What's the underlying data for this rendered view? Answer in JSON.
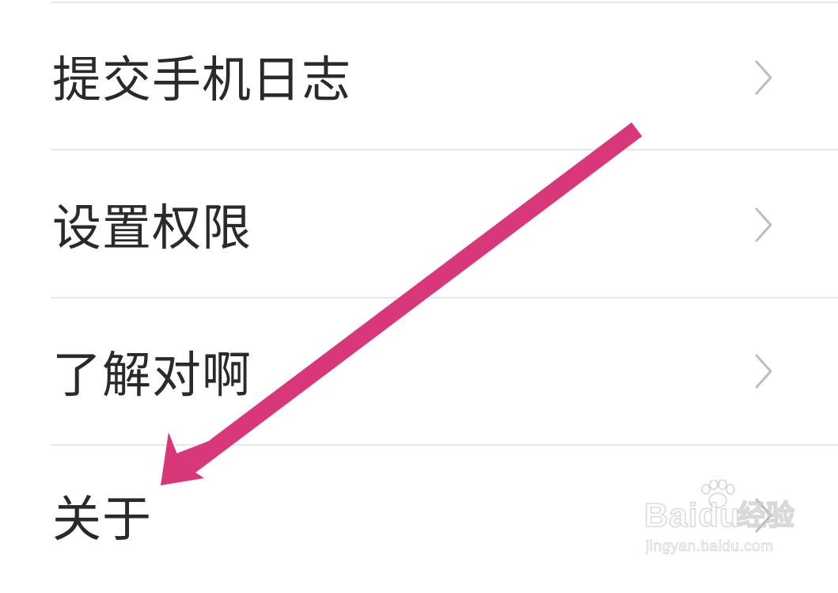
{
  "settings": {
    "items": [
      {
        "label": "提交手机日志"
      },
      {
        "label": "设置权限"
      },
      {
        "label": "了解对啊"
      },
      {
        "label": "关于"
      }
    ]
  },
  "annotation": {
    "arrow_color": "#d8377a"
  },
  "watermark": {
    "logo_text": "Baidu",
    "suffix_text": "经验",
    "url": "jingyan.baidu.com"
  },
  "colors": {
    "text": "#2a2a2a",
    "divider": "#e8e8e8",
    "chevron": "#bdbdbd",
    "background": "#ffffff"
  },
  "icons": {
    "chevron": "chevron-right-icon",
    "arrow": "arrow-down-left-icon",
    "watermark": "baidu-paw-icon"
  }
}
